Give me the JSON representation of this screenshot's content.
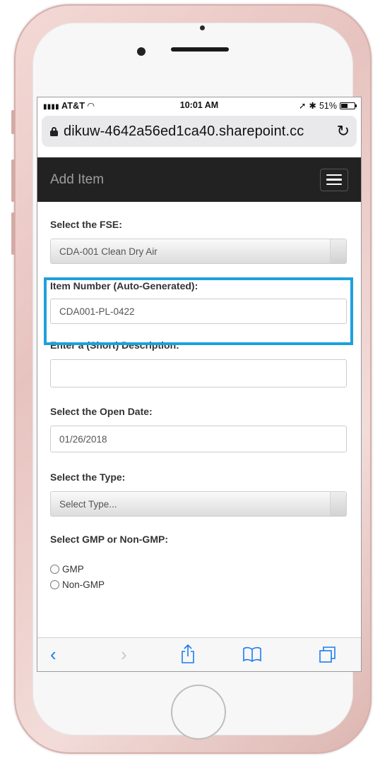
{
  "status_bar": {
    "carrier": "AT&T",
    "time": "10:01 AM",
    "battery": "51%",
    "battery_level": 0.51
  },
  "browser": {
    "url": "dikuw-4642a56ed1ca40.sharepoint.cc"
  },
  "navbar": {
    "title": "Add Item"
  },
  "form": {
    "fse": {
      "label": "Select the FSE:",
      "value": "CDA-001 Clean Dry Air"
    },
    "item_number": {
      "label": "Item Number (Auto-Generated):",
      "value": "CDA001-PL-0422"
    },
    "description": {
      "label": "Enter a (Short) Description:",
      "value": ""
    },
    "open_date": {
      "label": "Select the Open Date:",
      "value": "01/26/2018"
    },
    "type": {
      "label": "Select the Type:",
      "value": "Select Type..."
    },
    "gmp": {
      "label": "Select GMP or Non-GMP:",
      "options": [
        "GMP",
        "Non-GMP"
      ]
    }
  },
  "colors": {
    "highlight": "#1ea1dc",
    "navbar": "#222222",
    "ios_blue": "#1a7cf0"
  }
}
